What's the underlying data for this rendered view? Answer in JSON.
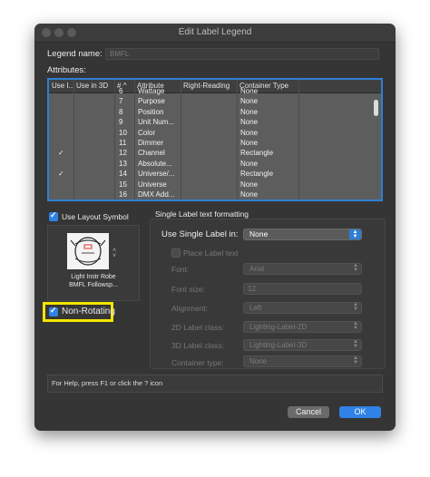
{
  "window": {
    "title": "Edit Label Legend"
  },
  "legend_name": {
    "label": "Legend name:",
    "value": "BMFL"
  },
  "attributes": {
    "label": "Attributes:",
    "columns": [
      "Use I...",
      "Use in 3D",
      "#",
      "Attribute",
      "Right-Reading",
      "Container Type"
    ],
    "rows": [
      {
        "use_in": "",
        "num": "6",
        "attribute": "Wattage",
        "container": "None"
      },
      {
        "use_in": "",
        "num": "7",
        "attribute": "Purpose",
        "container": "None"
      },
      {
        "use_in": "",
        "num": "8",
        "attribute": "Position",
        "container": "None"
      },
      {
        "use_in": "",
        "num": "9",
        "attribute": "Unit Num...",
        "container": "None"
      },
      {
        "use_in": "",
        "num": "10",
        "attribute": "Color",
        "container": "None"
      },
      {
        "use_in": "",
        "num": "11",
        "attribute": "Dimmer",
        "container": "None"
      },
      {
        "use_in": "✓",
        "num": "12",
        "attribute": "Channel",
        "container": "Rectangle"
      },
      {
        "use_in": "",
        "num": "13",
        "attribute": "Absolute...",
        "container": "None"
      },
      {
        "use_in": "✓",
        "num": "14",
        "attribute": "Universe/...",
        "container": "Rectangle"
      },
      {
        "use_in": "",
        "num": "15",
        "attribute": "Universe",
        "container": "None"
      },
      {
        "use_in": "",
        "num": "16",
        "attribute": "DMX Add...",
        "container": "None"
      }
    ]
  },
  "layout_symbol": {
    "checkbox_label": "Use Layout Symbol",
    "checked": true,
    "symbol_name_line1": "Light Instr Robe",
    "symbol_name_line2": "BMFL Followsp..."
  },
  "non_rotating": {
    "label": "Non-Rotating",
    "checked": true,
    "highlight_color": "#f2e600"
  },
  "single_label": {
    "group_title": "Single Label text formatting",
    "use_label": "Use Single Label in:",
    "use_value": "None",
    "place_label": "Place Label text",
    "font_label": "Font:",
    "font_value": "Arial",
    "size_label": "Font size:",
    "size_value": "12",
    "align_label": "Alignment:",
    "align_value": "Left",
    "class2d_label": "2D Label class:",
    "class2d_value": "Lighting-Label-2D",
    "class3d_label": "3D Label class:",
    "class3d_value": "Lighting-Label-3D",
    "container_label": "Container type:",
    "container_value": "None"
  },
  "help": {
    "text": "For Help, press F1 or click the ? icon"
  },
  "buttons": {
    "cancel": "Cancel",
    "ok": "OK"
  },
  "colors": {
    "accent": "#2f82e6",
    "window_bg": "#353535"
  }
}
